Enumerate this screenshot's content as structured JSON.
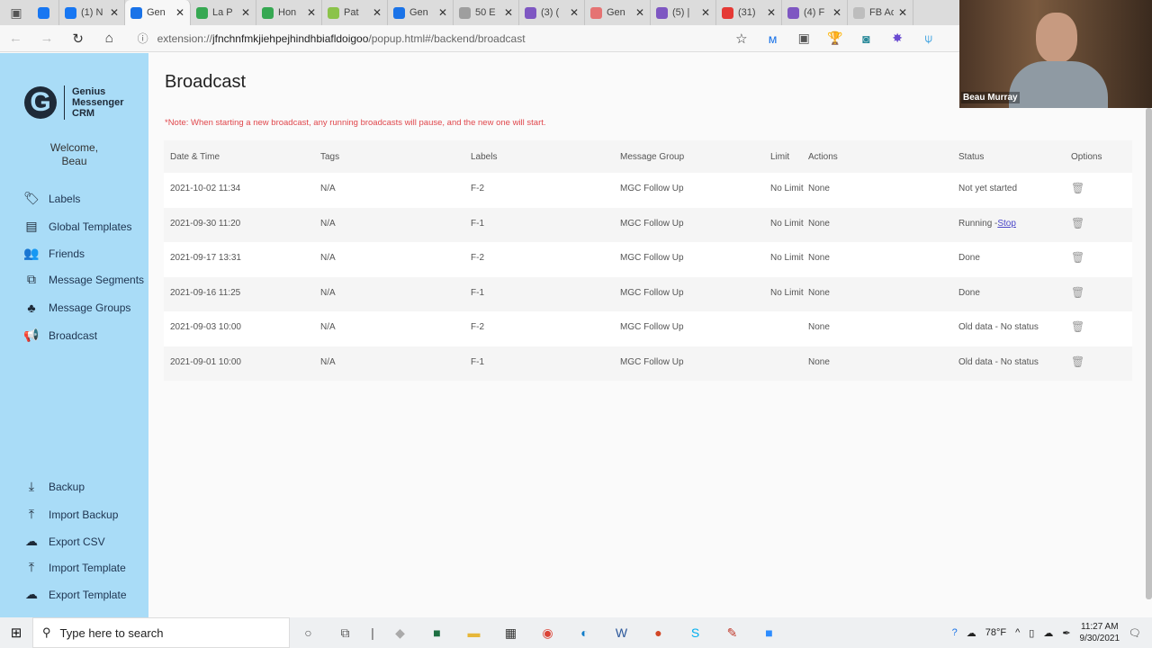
{
  "browser": {
    "tabs": [
      {
        "label": "",
        "color": "#1877f2"
      },
      {
        "label": "(1) N",
        "color": "#1877f2"
      },
      {
        "label": "Gen",
        "color": "#1a73e8",
        "active": true
      },
      {
        "label": "La P",
        "color": "#36a852"
      },
      {
        "label": "Hon",
        "color": "#36a852"
      },
      {
        "label": "Pat",
        "color": "#8bc34a"
      },
      {
        "label": "Gen",
        "color": "#1a73e8"
      },
      {
        "label": "50 E",
        "color": "#9e9e9e"
      },
      {
        "label": "(3) (",
        "color": "#7e57c2"
      },
      {
        "label": "Gen",
        "color": "#e57373"
      },
      {
        "label": "(5) |",
        "color": "#7e57c2"
      },
      {
        "label": "(31)",
        "color": "#e53935"
      },
      {
        "label": "(4) F",
        "color": "#7e57c2"
      },
      {
        "label": "FB Ad",
        "color": "#bdbdbd"
      }
    ],
    "url_prefix": "extension://",
    "url_host": "jfnchnfmkjiehpejhindhbiafldoigoo",
    "url_path": "/popup.html#/backend/broadcast"
  },
  "sidebar": {
    "logo": [
      "Genius",
      "Messenger",
      "CRM"
    ],
    "welcome": "Welcome,",
    "user": "Beau",
    "items": [
      {
        "label": "Labels",
        "icon": "tag-icon"
      },
      {
        "label": "Global Templates",
        "icon": "chat-icon"
      },
      {
        "label": "Friends",
        "icon": "users-icon"
      },
      {
        "label": "Message Segments",
        "icon": "segments-icon"
      },
      {
        "label": "Message Groups",
        "icon": "sitemap-icon"
      },
      {
        "label": "Broadcast",
        "icon": "megaphone-icon"
      }
    ],
    "bottom": [
      {
        "label": "Backup",
        "icon": "download-icon"
      },
      {
        "label": "Import Backup",
        "icon": "upload-icon"
      },
      {
        "label": "Export CSV",
        "icon": "cloud-download-icon"
      },
      {
        "label": "Import Template",
        "icon": "upload-icon"
      },
      {
        "label": "Export Template",
        "icon": "cloud-download-icon"
      }
    ]
  },
  "main": {
    "title": "Broadcast",
    "note": "*Note: When starting a new broadcast, any running broadcasts will pause, and the new one will start.",
    "columns": [
      "Date & Time",
      "Tags",
      "Labels",
      "Message Group",
      "Limit",
      "Actions",
      "Status",
      "Options"
    ],
    "rows": [
      {
        "date": "2021-10-02 11:34",
        "tags": "N/A",
        "labels": "F-2",
        "group": "MGC Follow Up",
        "limit": "No Limit",
        "actions": "None",
        "status": "Not yet started"
      },
      {
        "date": "2021-09-30 11:20",
        "tags": "N/A",
        "labels": "F-1",
        "group": "MGC Follow Up",
        "limit": "No Limit",
        "actions": "None",
        "status": "Running -",
        "status_link": "Stop"
      },
      {
        "date": "2021-09-17 13:31",
        "tags": "N/A",
        "labels": "F-2",
        "group": "MGC Follow Up",
        "limit": "No Limit",
        "actions": "None",
        "status": "Done"
      },
      {
        "date": "2021-09-16 11:25",
        "tags": "N/A",
        "labels": "F-1",
        "group": "MGC Follow Up",
        "limit": "No Limit",
        "actions": "None",
        "status": "Done"
      },
      {
        "date": "2021-09-03 10:00",
        "tags": "N/A",
        "labels": "F-2",
        "group": "MGC Follow Up",
        "limit": "",
        "actions": "None",
        "status": "Old data - No status"
      },
      {
        "date": "2021-09-01 10:00",
        "tags": "N/A",
        "labels": "F-1",
        "group": "MGC Follow Up",
        "limit": "",
        "actions": "None",
        "status": "Old data - No status"
      }
    ]
  },
  "webcam": {
    "name": "Beau Murray"
  },
  "taskbar": {
    "search_placeholder": "Type here to search",
    "weather": "78°F",
    "time": "11:27 AM",
    "date": "9/30/2021"
  }
}
